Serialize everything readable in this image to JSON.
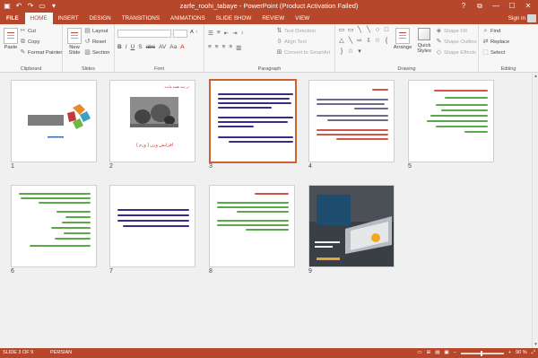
{
  "titlebar": {
    "title": "zarfe_roohi_tabaye - PowerPoint (Product Activation Failed)",
    "qat_icons": [
      "save-icon",
      "undo-icon",
      "redo-icon",
      "slideshow-icon",
      "customize-icon"
    ],
    "controls": [
      "?",
      "⧉",
      "—",
      "☐",
      "✕"
    ]
  },
  "tabs": {
    "file": "FILE",
    "items": [
      "HOME",
      "INSERT",
      "DESIGN",
      "TRANSITIONS",
      "ANIMATIONS",
      "SLIDE SHOW",
      "REVIEW",
      "VIEW"
    ],
    "active": "HOME",
    "sign_in": "Sign in"
  },
  "ribbon": {
    "clipboard": {
      "paste": "Paste",
      "cut": "Cut",
      "copy": "Copy",
      "format_painter": "Format Painter",
      "label": "Clipboard"
    },
    "slides": {
      "new_slide": "New Slide",
      "layout": "Layout",
      "reset": "Reset",
      "section": "Section",
      "label": "Slides"
    },
    "font": {
      "format_buttons": [
        "B",
        "I",
        "U",
        "S",
        "abc",
        "AV",
        "Aa",
        "A"
      ],
      "label": "Font"
    },
    "paragraph": {
      "text_direction": "Text Direction",
      "align_text": "Align Text",
      "convert_smartart": "Convert to SmartArt",
      "label": "Paragraph"
    },
    "drawing": {
      "arrange": "Arrange",
      "quick_styles": "Quick Styles",
      "shape_fill": "Shape Fill",
      "shape_outline": "Shape Outline",
      "shape_effects": "Shape Effects",
      "label": "Drawing"
    },
    "editing": {
      "find": "Find",
      "replace": "Replace",
      "select": "Select",
      "label": "Editing"
    }
  },
  "slides": [
    {
      "number": "1"
    },
    {
      "number": "2",
      "title": "در چند هفته مانده",
      "caption": "افزایش وزن ( ورم )"
    },
    {
      "number": "3"
    },
    {
      "number": "4"
    },
    {
      "number": "5"
    },
    {
      "number": "6"
    },
    {
      "number": "7"
    },
    {
      "number": "8"
    },
    {
      "number": "9"
    }
  ],
  "status": {
    "slide_info": "SLIDE 3 OF 9",
    "language": "PERSIAN",
    "zoom": "90 %"
  },
  "colors": {
    "accent": "#b7472a",
    "selected_border": "#d0602f",
    "ribbon_bg": "#f7f7f7"
  }
}
